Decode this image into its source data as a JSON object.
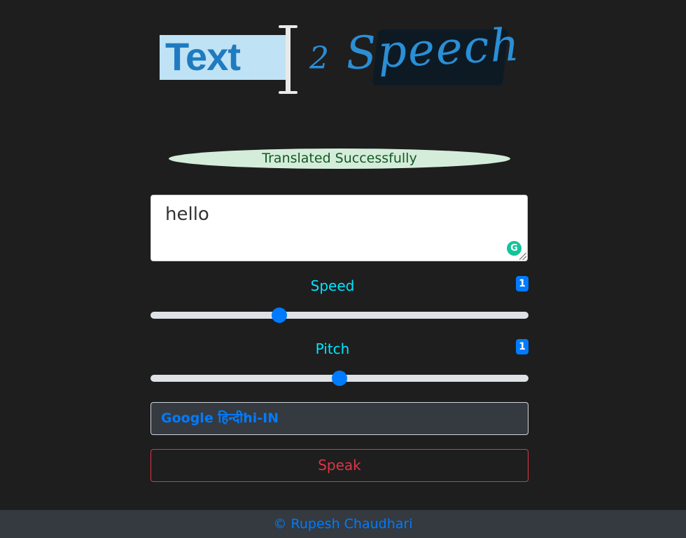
{
  "logo": {
    "text": "Text",
    "two": "2",
    "speech": "Speech"
  },
  "alert": {
    "message": "Translated Successfully",
    "background": "#d4edda",
    "color": "#155724"
  },
  "text_input": {
    "value": "hello",
    "grammarly_icon": "G"
  },
  "speed": {
    "label": "Speed",
    "value_badge": "1",
    "slider_value": 0.34
  },
  "pitch": {
    "label": "Pitch",
    "value_badge": "1",
    "slider_value": 0.5
  },
  "voice_select": {
    "selected": "Google हिन्दीhi-IN"
  },
  "speak_button": {
    "label": "Speak"
  },
  "footer": {
    "text": "© Rupesh Chaudhari"
  },
  "colors": {
    "background": "#1e1e1e",
    "accent": "#007bff",
    "label": "#00e5ff",
    "danger": "#dc3545",
    "footer_bg": "#343a40"
  },
  "icons": [
    "text-cursor-icon",
    "grammarly-icon",
    "resize-handle-icon"
  ]
}
